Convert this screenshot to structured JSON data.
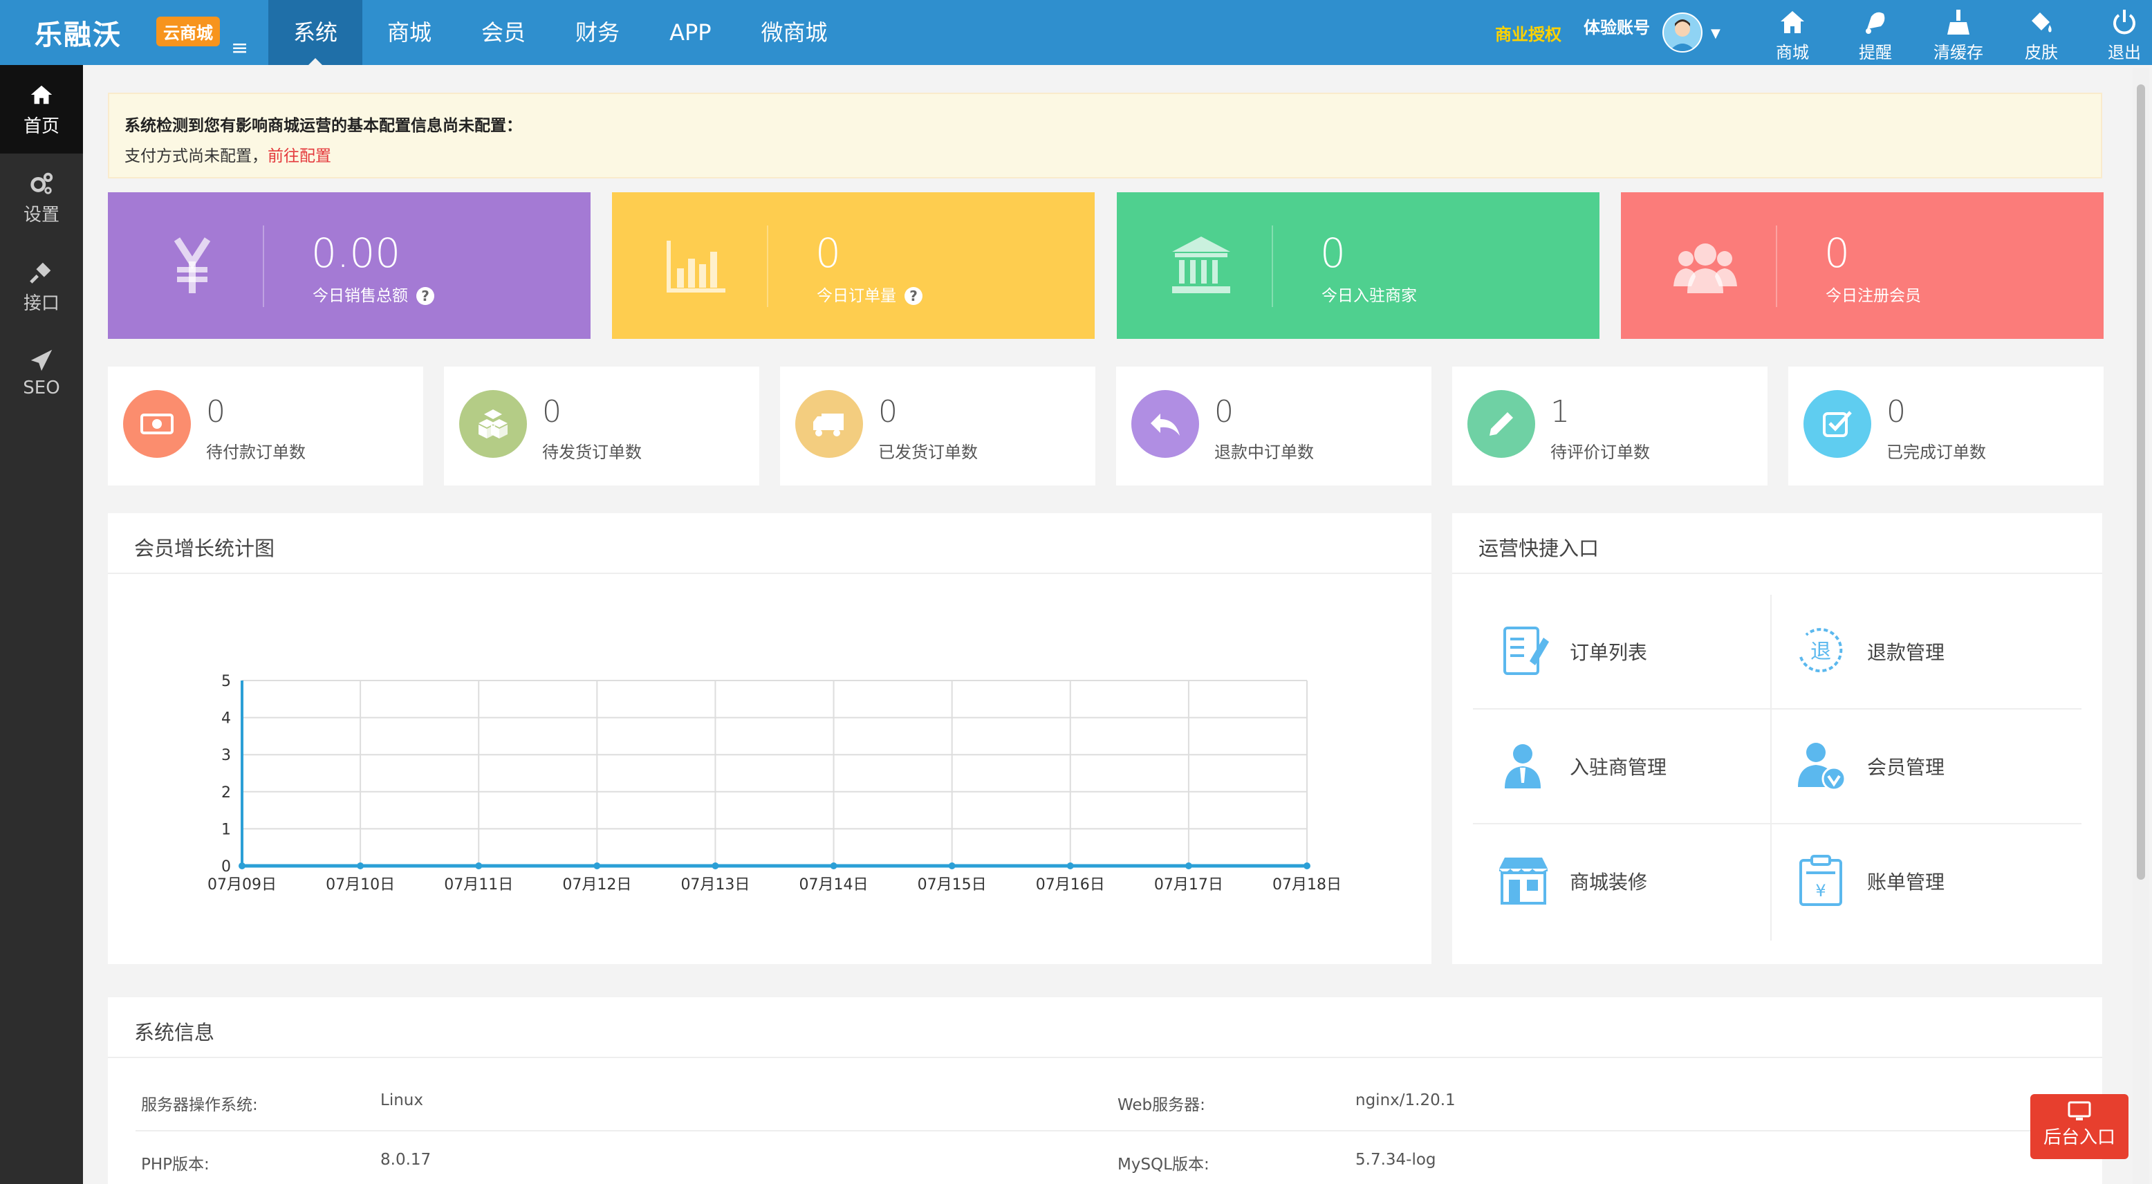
{
  "header": {
    "logo": "乐融沃",
    "logo_badge": "云商城",
    "nav": [
      "系统",
      "商城",
      "会员",
      "财务",
      "APP",
      "微商城"
    ],
    "license": "商业授权",
    "account": "体验账号",
    "tools": [
      {
        "icon": "home-icon",
        "label": "商城"
      },
      {
        "icon": "bell-icon",
        "label": "提醒"
      },
      {
        "icon": "broom-icon",
        "label": "清缓存"
      },
      {
        "icon": "paint-bucket-icon",
        "label": "皮肤"
      },
      {
        "icon": "power-icon",
        "label": "退出"
      }
    ]
  },
  "sidebar": [
    {
      "icon": "home-icon",
      "label": "首页"
    },
    {
      "icon": "gears-icon",
      "label": "设置"
    },
    {
      "icon": "plug-icon",
      "label": "接口"
    },
    {
      "icon": "paper-plane-icon",
      "label": "SEO"
    }
  ],
  "notice": {
    "title": "系统检测到您有影响商城运营的基本配置信息尚未配置：",
    "text": "支付方式尚未配置，",
    "link": "前往配置"
  },
  "stats": [
    {
      "value": "0.00",
      "label": "今日销售总额",
      "color": "#a47ad4",
      "icon": "yen-icon",
      "help": "?"
    },
    {
      "value": "0",
      "label": "今日订单量",
      "color": "#fecd4f",
      "icon": "bar-chart-icon",
      "help": "?"
    },
    {
      "value": "0",
      "label": "今日入驻商家",
      "color": "#4fd08f",
      "icon": "bank-icon"
    },
    {
      "value": "0",
      "label": "今日注册会员",
      "color": "#fb7c7a",
      "icon": "users-icon"
    }
  ],
  "orders": [
    {
      "value": "0",
      "label": "待付款订单数",
      "color": "#fb8d6e",
      "icon": "money-icon"
    },
    {
      "value": "0",
      "label": "待发货订单数",
      "color": "#b4cc86",
      "icon": "boxes-icon"
    },
    {
      "value": "0",
      "label": "已发货订单数",
      "color": "#f3cd7f",
      "icon": "truck-icon"
    },
    {
      "value": "0",
      "label": "退款中订单数",
      "color": "#b08ee3",
      "icon": "reply-icon"
    },
    {
      "value": "1",
      "label": "待评价订单数",
      "color": "#6fd1a4",
      "icon": "pencil-icon"
    },
    {
      "value": "0",
      "label": "已完成订单数",
      "color": "#5fcdf0",
      "icon": "check-square-icon"
    }
  ],
  "chart_panel_title": "会员增长统计图",
  "chart_data": {
    "type": "line",
    "title": "",
    "categories": [
      "07月09日",
      "07月10日",
      "07月11日",
      "07月12日",
      "07月13日",
      "07月14日",
      "07月15日",
      "07月16日",
      "07月17日",
      "07月18日"
    ],
    "series": [
      {
        "values": [
          0,
          0,
          0,
          0,
          0,
          0,
          0,
          0,
          0,
          0
        ]
      }
    ],
    "ylim": [
      0,
      5
    ],
    "yticks": [
      "0",
      "1",
      "2",
      "3",
      "4",
      "5"
    ],
    "grid": true,
    "line_color": "#2b9fd6"
  },
  "quick_panel_title": "运营快捷入口",
  "quick": [
    {
      "icon": "order-list-icon",
      "label": "订单列表"
    },
    {
      "icon": "refund-icon",
      "label": "退款管理"
    },
    {
      "icon": "merchant-icon",
      "label": "入驻商管理"
    },
    {
      "icon": "member-icon",
      "label": "会员管理"
    },
    {
      "icon": "store-decor-icon",
      "label": "商城装修"
    },
    {
      "icon": "bill-icon",
      "label": "账单管理"
    }
  ],
  "system": {
    "title": "系统信息",
    "rows": [
      {
        "label1": "服务器操作系统:",
        "value1": "Linux",
        "label2": "Web服务器:",
        "value2": "nginx/1.20.1"
      },
      {
        "label1": "PHP版本:",
        "value1": "8.0.17",
        "label2": "MySQL版本:",
        "value2": "5.7.34-log"
      }
    ]
  },
  "backend_button": "后台入口"
}
